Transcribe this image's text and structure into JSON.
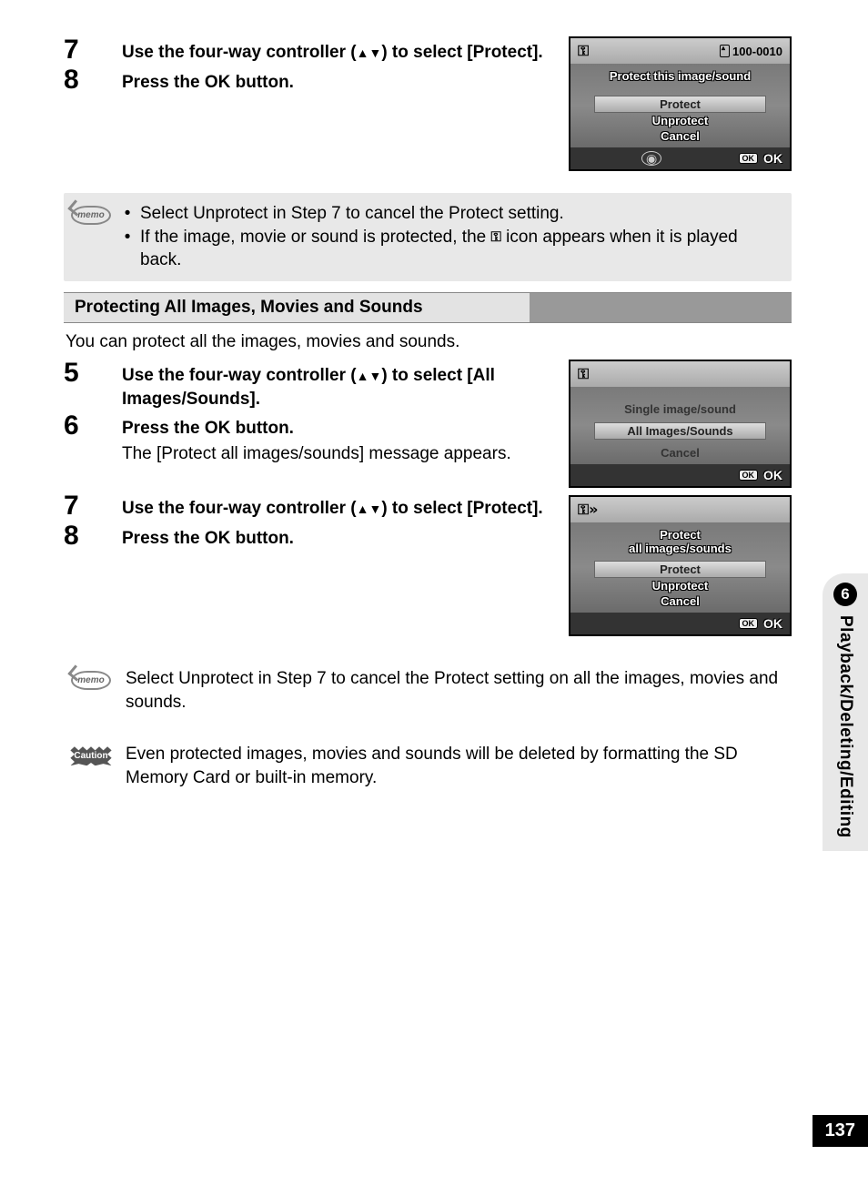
{
  "steps_a": [
    {
      "n": "7",
      "bold_a": "Use the four-way controller (",
      "bold_b": ") to select [Protect]."
    },
    {
      "n": "8",
      "bold_a": "Press the OK button.",
      "bold_b": ""
    }
  ],
  "lcd1": {
    "folder": "100-0010",
    "title": "Protect this image/sound",
    "opts": [
      "Protect",
      "Unprotect",
      "Cancel"
    ],
    "hi": 0,
    "ok": "OK"
  },
  "memo1_a": "Select Unprotect in Step 7 to cancel the Protect setting.",
  "memo1_b_a": "If the image, movie or sound is protected, the ",
  "memo1_b_b": " icon appears when it is played back.",
  "section": "Protecting All Images, Movies and Sounds",
  "intro": "You can protect all the images, movies and sounds.",
  "steps_b": [
    {
      "n": "5",
      "bold_a": "Use the four-way controller (",
      "bold_b": ") to select [All Images/Sounds]."
    },
    {
      "n": "6",
      "bold_a": "Press the OK button.",
      "bold_b": "",
      "sub": "The [Protect all images/sounds] message appears."
    },
    {
      "n": "7",
      "bold_a": "Use the four-way controller (",
      "bold_b": ") to select [Protect]."
    },
    {
      "n": "8",
      "bold_a": "Press the OK button.",
      "bold_b": ""
    }
  ],
  "lcd2": {
    "opts": [
      "Single image/sound",
      "All Images/Sounds",
      "Cancel"
    ],
    "hi": 1,
    "ok": "OK"
  },
  "lcd3": {
    "title_a": "Protect",
    "title_b": "all images/sounds",
    "opts": [
      "Protect",
      "Unprotect",
      "Cancel"
    ],
    "hi": 0,
    "ok": "OK"
  },
  "memo2": "Select Unprotect in Step 7 to cancel the Protect setting on all the images, movies and sounds.",
  "caution": "Even protected images, movies and sounds will be deleted by formatting the SD Memory Card or built-in memory.",
  "tab": {
    "num": "6",
    "label": "Playback/Deleting/Editing"
  },
  "page": "137"
}
